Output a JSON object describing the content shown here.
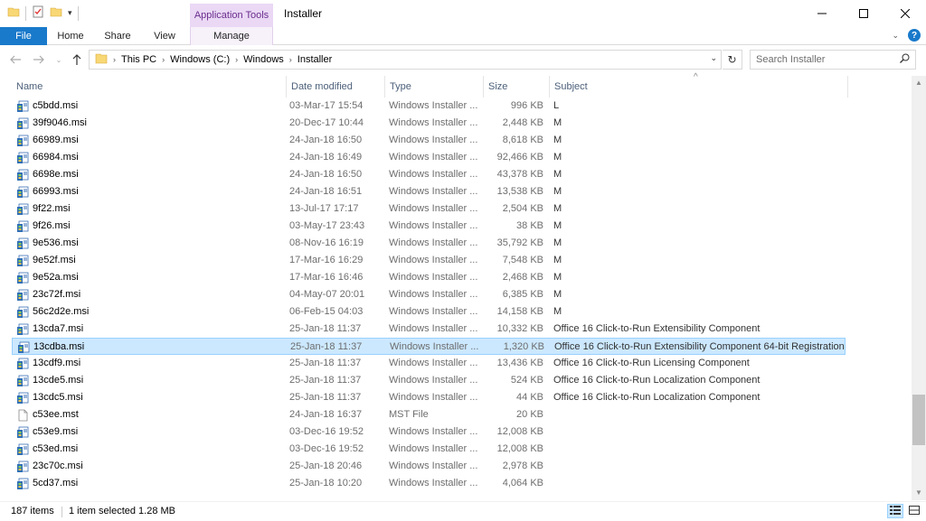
{
  "window": {
    "title": "Installer"
  },
  "ribbon": {
    "context_group": "Application Tools",
    "tabs": [
      "File",
      "Home",
      "Share",
      "View",
      "Manage"
    ]
  },
  "address": {
    "crumbs": [
      "This PC",
      "Windows (C:)",
      "Windows",
      "Installer"
    ],
    "search_placeholder": "Search Installer"
  },
  "columns": {
    "name": "Name",
    "date": "Date modified",
    "type": "Type",
    "size": "Size",
    "subject": "Subject"
  },
  "files": [
    {
      "name": "c5bdd.msi",
      "date": "03-Mar-17 15:54",
      "type": "Windows Installer ...",
      "size": "996 KB",
      "subject": "L",
      "icon": "msi-icon"
    },
    {
      "name": "39f9046.msi",
      "date": "20-Dec-17 10:44",
      "type": "Windows Installer ...",
      "size": "2,448 KB",
      "subject": "M",
      "icon": "msi-icon"
    },
    {
      "name": "66989.msi",
      "date": "24-Jan-18 16:50",
      "type": "Windows Installer ...",
      "size": "8,618 KB",
      "subject": "M",
      "icon": "msi-icon"
    },
    {
      "name": "66984.msi",
      "date": "24-Jan-18 16:49",
      "type": "Windows Installer ...",
      "size": "92,466 KB",
      "subject": "M",
      "icon": "msi-icon"
    },
    {
      "name": "6698e.msi",
      "date": "24-Jan-18 16:50",
      "type": "Windows Installer ...",
      "size": "43,378 KB",
      "subject": "M",
      "icon": "msi-icon"
    },
    {
      "name": "66993.msi",
      "date": "24-Jan-18 16:51",
      "type": "Windows Installer ...",
      "size": "13,538 KB",
      "subject": "M",
      "icon": "msi-icon"
    },
    {
      "name": "9f22.msi",
      "date": "13-Jul-17 17:17",
      "type": "Windows Installer ...",
      "size": "2,504 KB",
      "subject": "M",
      "icon": "msi-icon"
    },
    {
      "name": "9f26.msi",
      "date": "03-May-17 23:43",
      "type": "Windows Installer ...",
      "size": "38 KB",
      "subject": "M",
      "icon": "msi-icon"
    },
    {
      "name": "9e536.msi",
      "date": "08-Nov-16 16:19",
      "type": "Windows Installer ...",
      "size": "35,792 KB",
      "subject": "M",
      "icon": "msi-icon"
    },
    {
      "name": "9e52f.msi",
      "date": "17-Mar-16 16:29",
      "type": "Windows Installer ...",
      "size": "7,548 KB",
      "subject": "M",
      "icon": "msi-icon"
    },
    {
      "name": "9e52a.msi",
      "date": "17-Mar-16 16:46",
      "type": "Windows Installer ...",
      "size": "2,468 KB",
      "subject": "M",
      "icon": "msi-icon"
    },
    {
      "name": "23c72f.msi",
      "date": "04-May-07 20:01",
      "type": "Windows Installer ...",
      "size": "6,385 KB",
      "subject": "M",
      "icon": "msi-icon"
    },
    {
      "name": "56c2d2e.msi",
      "date": "06-Feb-15 04:03",
      "type": "Windows Installer ...",
      "size": "14,158 KB",
      "subject": "M",
      "icon": "msi-icon"
    },
    {
      "name": "13cda7.msi",
      "date": "25-Jan-18 11:37",
      "type": "Windows Installer ...",
      "size": "10,332 KB",
      "subject": "Office 16 Click-to-Run Extensibility Component",
      "icon": "msi-icon"
    },
    {
      "name": "13cdba.msi",
      "date": "25-Jan-18 11:37",
      "type": "Windows Installer ...",
      "size": "1,320 KB",
      "subject": "Office 16 Click-to-Run Extensibility Component 64-bit Registration",
      "icon": "msi-icon",
      "selected": true
    },
    {
      "name": "13cdf9.msi",
      "date": "25-Jan-18 11:37",
      "type": "Windows Installer ...",
      "size": "13,436 KB",
      "subject": "Office 16 Click-to-Run Licensing Component",
      "icon": "msi-icon"
    },
    {
      "name": "13cde5.msi",
      "date": "25-Jan-18 11:37",
      "type": "Windows Installer ...",
      "size": "524 KB",
      "subject": "Office 16 Click-to-Run Localization Component",
      "icon": "msi-icon"
    },
    {
      "name": "13cdc5.msi",
      "date": "25-Jan-18 11:37",
      "type": "Windows Installer ...",
      "size": "44 KB",
      "subject": "Office 16 Click-to-Run Localization Component",
      "icon": "msi-icon"
    },
    {
      "name": "c53ee.mst",
      "date": "24-Jan-18 16:37",
      "type": "MST File",
      "size": "20 KB",
      "subject": "",
      "icon": "file-icon"
    },
    {
      "name": "c53e9.msi",
      "date": "03-Dec-16 19:52",
      "type": "Windows Installer ...",
      "size": "12,008 KB",
      "subject": "",
      "icon": "msi-icon"
    },
    {
      "name": "c53ed.msi",
      "date": "03-Dec-16 19:52",
      "type": "Windows Installer ...",
      "size": "12,008 KB",
      "subject": "",
      "icon": "msi-icon"
    },
    {
      "name": "23c70c.msi",
      "date": "25-Jan-18 20:46",
      "type": "Windows Installer ...",
      "size": "2,978 KB",
      "subject": "",
      "icon": "msi-icon"
    },
    {
      "name": "5cd37.msi",
      "date": "25-Jan-18 10:20",
      "type": "Windows Installer ...",
      "size": "4,064 KB",
      "subject": "",
      "icon": "msi-icon"
    }
  ],
  "status": {
    "count": "187 items",
    "selection": "1 item selected  1.28 MB"
  },
  "colors": {
    "accent": "#1979ca",
    "selection": "#cce8ff",
    "context_tab": "#ead8f5"
  }
}
